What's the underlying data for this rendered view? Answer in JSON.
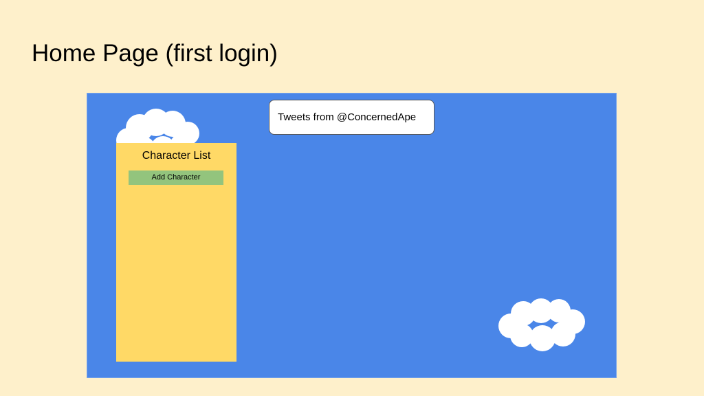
{
  "page": {
    "title": "Home Page (first login)"
  },
  "character_list": {
    "title": "Character List",
    "add_button_label": "Add Character"
  },
  "tweets": {
    "label": "Tweets from @ConcernedApe"
  },
  "colors": {
    "background": "#fef0cb",
    "sky": "#4a86e8",
    "panel": "#ffd966",
    "button": "#93c47d",
    "cloud": "#ffffff"
  },
  "icons": [
    "cloud-icon",
    "cloud-icon"
  ]
}
